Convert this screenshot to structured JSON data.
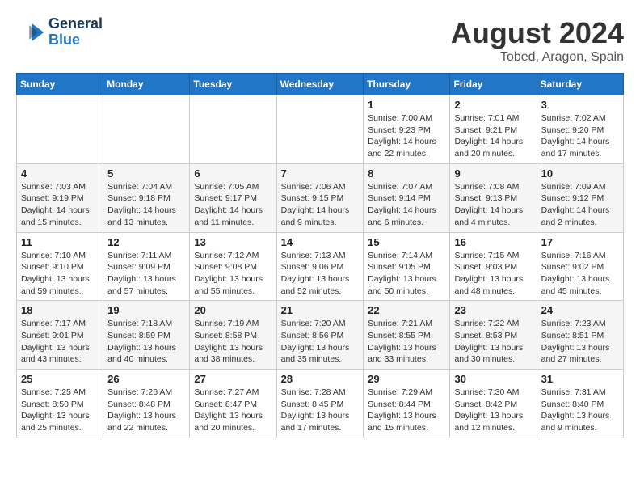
{
  "logo": {
    "line1": "General",
    "line2": "Blue"
  },
  "title": "August 2024",
  "location": "Tobed, Aragon, Spain",
  "weekdays": [
    "Sunday",
    "Monday",
    "Tuesday",
    "Wednesday",
    "Thursday",
    "Friday",
    "Saturday"
  ],
  "weeks": [
    [
      {
        "day": "",
        "info": ""
      },
      {
        "day": "",
        "info": ""
      },
      {
        "day": "",
        "info": ""
      },
      {
        "day": "",
        "info": ""
      },
      {
        "day": "1",
        "info": "Sunrise: 7:00 AM\nSunset: 9:23 PM\nDaylight: 14 hours\nand 22 minutes."
      },
      {
        "day": "2",
        "info": "Sunrise: 7:01 AM\nSunset: 9:21 PM\nDaylight: 14 hours\nand 20 minutes."
      },
      {
        "day": "3",
        "info": "Sunrise: 7:02 AM\nSunset: 9:20 PM\nDaylight: 14 hours\nand 17 minutes."
      }
    ],
    [
      {
        "day": "4",
        "info": "Sunrise: 7:03 AM\nSunset: 9:19 PM\nDaylight: 14 hours\nand 15 minutes."
      },
      {
        "day": "5",
        "info": "Sunrise: 7:04 AM\nSunset: 9:18 PM\nDaylight: 14 hours\nand 13 minutes."
      },
      {
        "day": "6",
        "info": "Sunrise: 7:05 AM\nSunset: 9:17 PM\nDaylight: 14 hours\nand 11 minutes."
      },
      {
        "day": "7",
        "info": "Sunrise: 7:06 AM\nSunset: 9:15 PM\nDaylight: 14 hours\nand 9 minutes."
      },
      {
        "day": "8",
        "info": "Sunrise: 7:07 AM\nSunset: 9:14 PM\nDaylight: 14 hours\nand 6 minutes."
      },
      {
        "day": "9",
        "info": "Sunrise: 7:08 AM\nSunset: 9:13 PM\nDaylight: 14 hours\nand 4 minutes."
      },
      {
        "day": "10",
        "info": "Sunrise: 7:09 AM\nSunset: 9:12 PM\nDaylight: 14 hours\nand 2 minutes."
      }
    ],
    [
      {
        "day": "11",
        "info": "Sunrise: 7:10 AM\nSunset: 9:10 PM\nDaylight: 13 hours\nand 59 minutes."
      },
      {
        "day": "12",
        "info": "Sunrise: 7:11 AM\nSunset: 9:09 PM\nDaylight: 13 hours\nand 57 minutes."
      },
      {
        "day": "13",
        "info": "Sunrise: 7:12 AM\nSunset: 9:08 PM\nDaylight: 13 hours\nand 55 minutes."
      },
      {
        "day": "14",
        "info": "Sunrise: 7:13 AM\nSunset: 9:06 PM\nDaylight: 13 hours\nand 52 minutes."
      },
      {
        "day": "15",
        "info": "Sunrise: 7:14 AM\nSunset: 9:05 PM\nDaylight: 13 hours\nand 50 minutes."
      },
      {
        "day": "16",
        "info": "Sunrise: 7:15 AM\nSunset: 9:03 PM\nDaylight: 13 hours\nand 48 minutes."
      },
      {
        "day": "17",
        "info": "Sunrise: 7:16 AM\nSunset: 9:02 PM\nDaylight: 13 hours\nand 45 minutes."
      }
    ],
    [
      {
        "day": "18",
        "info": "Sunrise: 7:17 AM\nSunset: 9:01 PM\nDaylight: 13 hours\nand 43 minutes."
      },
      {
        "day": "19",
        "info": "Sunrise: 7:18 AM\nSunset: 8:59 PM\nDaylight: 13 hours\nand 40 minutes."
      },
      {
        "day": "20",
        "info": "Sunrise: 7:19 AM\nSunset: 8:58 PM\nDaylight: 13 hours\nand 38 minutes."
      },
      {
        "day": "21",
        "info": "Sunrise: 7:20 AM\nSunset: 8:56 PM\nDaylight: 13 hours\nand 35 minutes."
      },
      {
        "day": "22",
        "info": "Sunrise: 7:21 AM\nSunset: 8:55 PM\nDaylight: 13 hours\nand 33 minutes."
      },
      {
        "day": "23",
        "info": "Sunrise: 7:22 AM\nSunset: 8:53 PM\nDaylight: 13 hours\nand 30 minutes."
      },
      {
        "day": "24",
        "info": "Sunrise: 7:23 AM\nSunset: 8:51 PM\nDaylight: 13 hours\nand 27 minutes."
      }
    ],
    [
      {
        "day": "25",
        "info": "Sunrise: 7:25 AM\nSunset: 8:50 PM\nDaylight: 13 hours\nand 25 minutes."
      },
      {
        "day": "26",
        "info": "Sunrise: 7:26 AM\nSunset: 8:48 PM\nDaylight: 13 hours\nand 22 minutes."
      },
      {
        "day": "27",
        "info": "Sunrise: 7:27 AM\nSunset: 8:47 PM\nDaylight: 13 hours\nand 20 minutes."
      },
      {
        "day": "28",
        "info": "Sunrise: 7:28 AM\nSunset: 8:45 PM\nDaylight: 13 hours\nand 17 minutes."
      },
      {
        "day": "29",
        "info": "Sunrise: 7:29 AM\nSunset: 8:44 PM\nDaylight: 13 hours\nand 15 minutes."
      },
      {
        "day": "30",
        "info": "Sunrise: 7:30 AM\nSunset: 8:42 PM\nDaylight: 13 hours\nand 12 minutes."
      },
      {
        "day": "31",
        "info": "Sunrise: 7:31 AM\nSunset: 8:40 PM\nDaylight: 13 hours\nand 9 minutes."
      }
    ]
  ]
}
